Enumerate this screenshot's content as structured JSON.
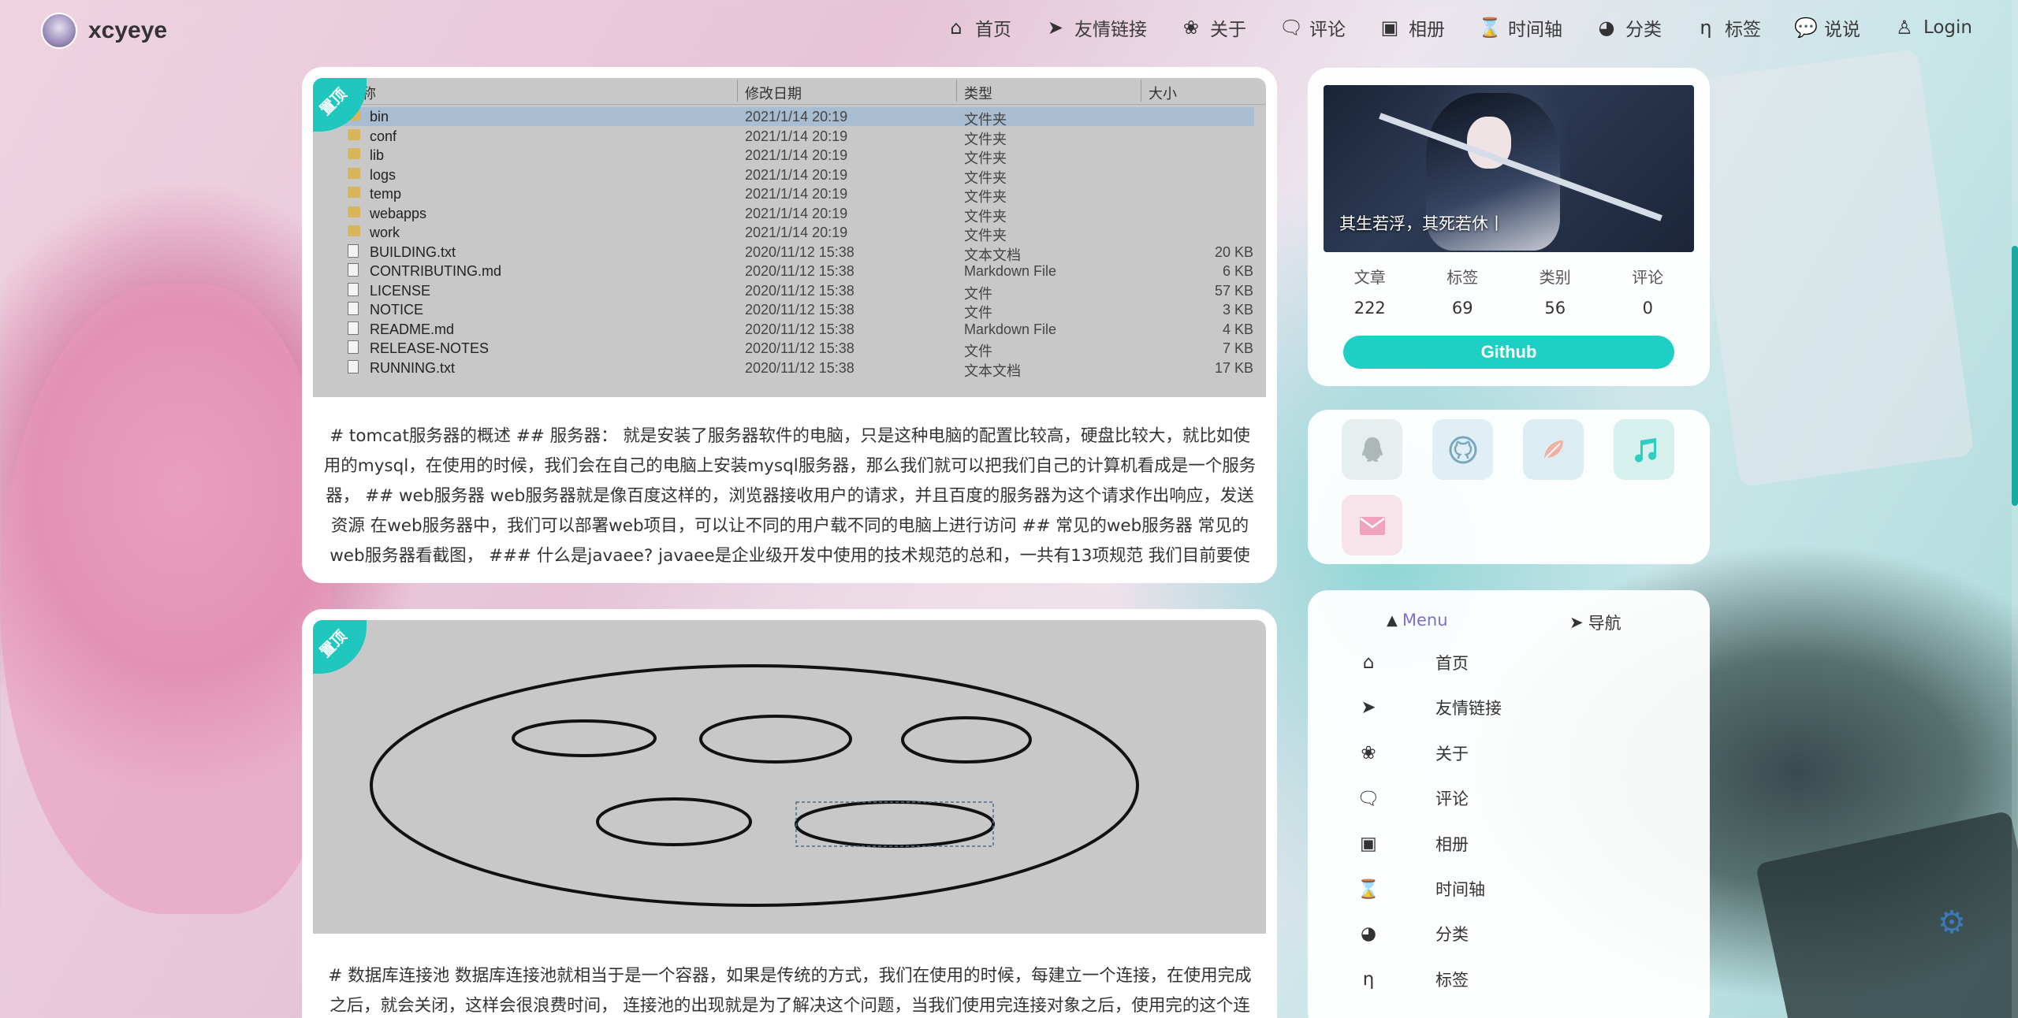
{
  "site": {
    "name": "xcyeye"
  },
  "nav": [
    {
      "icon": "home-icon",
      "label": "首页"
    },
    {
      "icon": "paper-plane-icon",
      "label": "友情链接"
    },
    {
      "icon": "leaf-icon",
      "label": "关于"
    },
    {
      "icon": "comments-icon",
      "label": "评论"
    },
    {
      "icon": "image-icon",
      "label": "相册"
    },
    {
      "icon": "hourglass-icon",
      "label": "时间轴"
    },
    {
      "icon": "pie-icon",
      "label": "分类"
    },
    {
      "icon": "tag-icon",
      "label": "标签"
    },
    {
      "icon": "chat-icon",
      "label": "说说"
    },
    {
      "icon": "user-icon",
      "label": "Login"
    }
  ],
  "posts": [
    {
      "badge": "置顶",
      "explorer": {
        "headers": {
          "name": "称",
          "date": "修改日期",
          "type": "类型",
          "size": "大小"
        },
        "rows": [
          {
            "kind": "folder",
            "name": "bin",
            "date": "2021/1/14 20:19",
            "type": "文件夹",
            "size": "",
            "selected": true
          },
          {
            "kind": "folder",
            "name": "conf",
            "date": "2021/1/14 20:19",
            "type": "文件夹",
            "size": ""
          },
          {
            "kind": "folder",
            "name": "lib",
            "date": "2021/1/14 20:19",
            "type": "文件夹",
            "size": ""
          },
          {
            "kind": "folder",
            "name": "logs",
            "date": "2021/1/14 20:19",
            "type": "文件夹",
            "size": ""
          },
          {
            "kind": "folder",
            "name": "temp",
            "date": "2021/1/14 20:19",
            "type": "文件夹",
            "size": ""
          },
          {
            "kind": "folder",
            "name": "webapps",
            "date": "2021/1/14 20:19",
            "type": "文件夹",
            "size": ""
          },
          {
            "kind": "folder",
            "name": "work",
            "date": "2021/1/14 20:19",
            "type": "文件夹",
            "size": ""
          },
          {
            "kind": "file",
            "name": "BUILDING.txt",
            "date": "2020/11/12 15:38",
            "type": "文本文档",
            "size": "20 KB"
          },
          {
            "kind": "file",
            "name": "CONTRIBUTING.md",
            "date": "2020/11/12 15:38",
            "type": "Markdown File",
            "size": "6 KB"
          },
          {
            "kind": "file",
            "name": "LICENSE",
            "date": "2020/11/12 15:38",
            "type": "文件",
            "size": "57 KB"
          },
          {
            "kind": "file",
            "name": "NOTICE",
            "date": "2020/11/12 15:38",
            "type": "文件",
            "size": "3 KB"
          },
          {
            "kind": "file",
            "name": "README.md",
            "date": "2020/11/12 15:38",
            "type": "Markdown File",
            "size": "4 KB"
          },
          {
            "kind": "file",
            "name": "RELEASE-NOTES",
            "date": "2020/11/12 15:38",
            "type": "文件",
            "size": "7 KB"
          },
          {
            "kind": "file",
            "name": "RUNNING.txt",
            "date": "2020/11/12 15:38",
            "type": "文本文档",
            "size": "17 KB"
          }
        ]
      },
      "excerpt": "# tomcat服务器的概述 ## 服务器： 就是安装了服务器软件的电脑，只是这种电脑的配置比较高，硬盘比较大，就比如使用的mysql，在使用的时候，我们会在自己的电脑上安装mysql服务器，那么我们就可以把我们自己的计算机看成是一个服务器， ## web服务器 web服务器就是像百度这样的，浏览器接收用户的请求，并且百度的服务器为这个请求作出响应，发送资源 在web服务器中，我们可以部署web项目，可以让不同的用户载不同的电脑上进行访问 ## 常见的web服务器 常见的web服务器看截图， ### 什么是javaee? javaee是企业级开发中使用的技术规范的总和，一共有13项规范 我们目前要使用的就是"
    },
    {
      "badge": "置顶",
      "excerpt": "# 数据库连接池 数据库连接池就相当于是一个容器，如果是传统的方式，我们在使用的时候，每建立一个连接，在使用完成之后，就会关闭，这样会很浪费时间， 连接池的出现就是为了解决这个问题，当我们使用完连接对象之后，使用完的这个连接不"
    }
  ],
  "profile": {
    "quote": "其生若浮，其死若休丨",
    "stats": [
      {
        "label": "文章",
        "value": "222"
      },
      {
        "label": "标签",
        "value": "69"
      },
      {
        "label": "类别",
        "value": "56"
      },
      {
        "label": "评论",
        "value": "0"
      }
    ],
    "github_label": "Github"
  },
  "social": [
    {
      "icon": "qq-icon",
      "color": "#e6eeee"
    },
    {
      "icon": "github-icon",
      "color": "#dfeff5"
    },
    {
      "icon": "gitee-icon",
      "color": "#dbedf2"
    },
    {
      "icon": "music-icon",
      "color": "#d6f0ee"
    },
    {
      "icon": "mail-icon",
      "color": "#f8e3ea"
    }
  ],
  "menu": {
    "tabs": {
      "menu": "Menu",
      "nav": "导航"
    },
    "items": [
      {
        "icon": "home-icon",
        "label": "首页"
      },
      {
        "icon": "paper-plane-icon",
        "label": "友情链接"
      },
      {
        "icon": "leaf-icon",
        "label": "关于"
      },
      {
        "icon": "comments-icon",
        "label": "评论"
      },
      {
        "icon": "image-icon",
        "label": "相册"
      },
      {
        "icon": "hourglass-icon",
        "label": "时间轴"
      },
      {
        "icon": "pie-icon",
        "label": "分类"
      },
      {
        "icon": "tag-icon",
        "label": "标签"
      }
    ]
  },
  "colors": {
    "accent": "#1dcfc4",
    "menu_active": "#7b6fd0"
  }
}
